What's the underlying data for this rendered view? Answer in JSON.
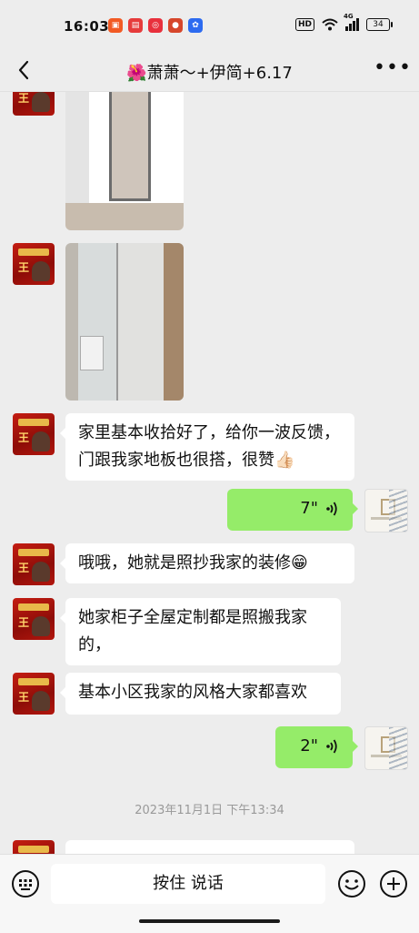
{
  "status_bar": {
    "time": "16:03",
    "hd": "HD",
    "net": "4G",
    "battery": "34",
    "app_icons": [
      {
        "name": "calendar-app-icon",
        "color": "#f25a24"
      },
      {
        "name": "shopping-app-icon",
        "color": "#e63b3b"
      },
      {
        "name": "pinduoduo-app-icon",
        "color": "#e8303c"
      },
      {
        "name": "camera-app-icon",
        "color": "#d6462b"
      },
      {
        "name": "baidu-app-icon",
        "color": "#2d6bf0"
      }
    ]
  },
  "nav": {
    "title": "萧萧～+伊简+6.17",
    "title_emoji": "🌺"
  },
  "messages": [
    {
      "type": "image",
      "sender": "other",
      "content": "door-photo"
    },
    {
      "type": "image",
      "sender": "other",
      "content": "glass-door-photo"
    },
    {
      "type": "text",
      "sender": "other",
      "text": "家里基本收拾好了，给你一波反馈，门跟我家地板也很搭，很赞👍🏻"
    },
    {
      "type": "voice",
      "sender": "me",
      "duration": "7\""
    },
    {
      "type": "text",
      "sender": "other",
      "text": "哦哦，她就是照抄我家的装修😁"
    },
    {
      "type": "text",
      "sender": "other",
      "text": "她家柜子全屋定制都是照搬我家的，"
    },
    {
      "type": "text",
      "sender": "other",
      "text": "基本小区我家的风格大家都喜欢"
    },
    {
      "type": "voice",
      "sender": "me",
      "duration": "2\""
    }
  ],
  "timestamp": "2023年11月1日 下午13:34",
  "input_bar": {
    "hold_to_talk": "按住 说话"
  },
  "colors": {
    "background": "#ededed",
    "my_bubble": "#95ec69",
    "their_bubble": "#ffffff"
  }
}
